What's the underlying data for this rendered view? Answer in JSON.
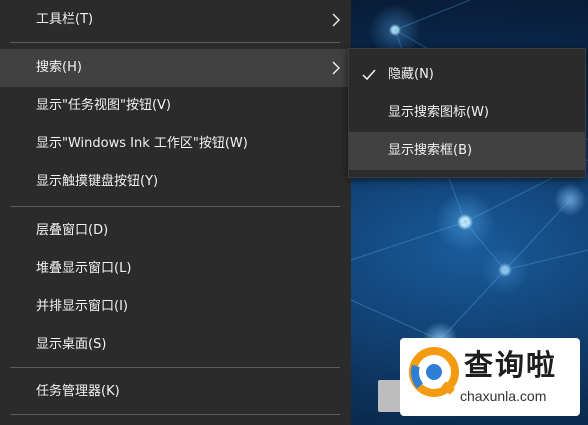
{
  "context_menu": {
    "items": [
      {
        "label": "工具栏(T)"
      },
      {
        "label": "搜索(H)"
      },
      {
        "label": "显示\"任务视图\"按钮(V)"
      },
      {
        "label": "显示\"Windows Ink 工作区\"按钮(W)"
      },
      {
        "label": "显示触摸键盘按钮(Y)"
      },
      {
        "label": "层叠窗口(D)"
      },
      {
        "label": "堆叠显示窗口(L)"
      },
      {
        "label": "并排显示窗口(I)"
      },
      {
        "label": "显示桌面(S)"
      },
      {
        "label": "任务管理器(K)"
      }
    ]
  },
  "search_submenu": {
    "items": [
      {
        "label": "隐藏(N)",
        "checked": true
      },
      {
        "label": "显示搜索图标(W)",
        "checked": false
      },
      {
        "label": "显示搜索框(B)",
        "checked": false
      }
    ]
  },
  "watermark": {
    "name": "查询啦",
    "url": "chaxunla.com"
  },
  "colors": {
    "menu_bg": "#2b2b2b",
    "menu_hover": "#414141",
    "menu_text": "#f2f2f2",
    "logo_orange": "#f39c12",
    "logo_blue": "#2f7fd6"
  }
}
